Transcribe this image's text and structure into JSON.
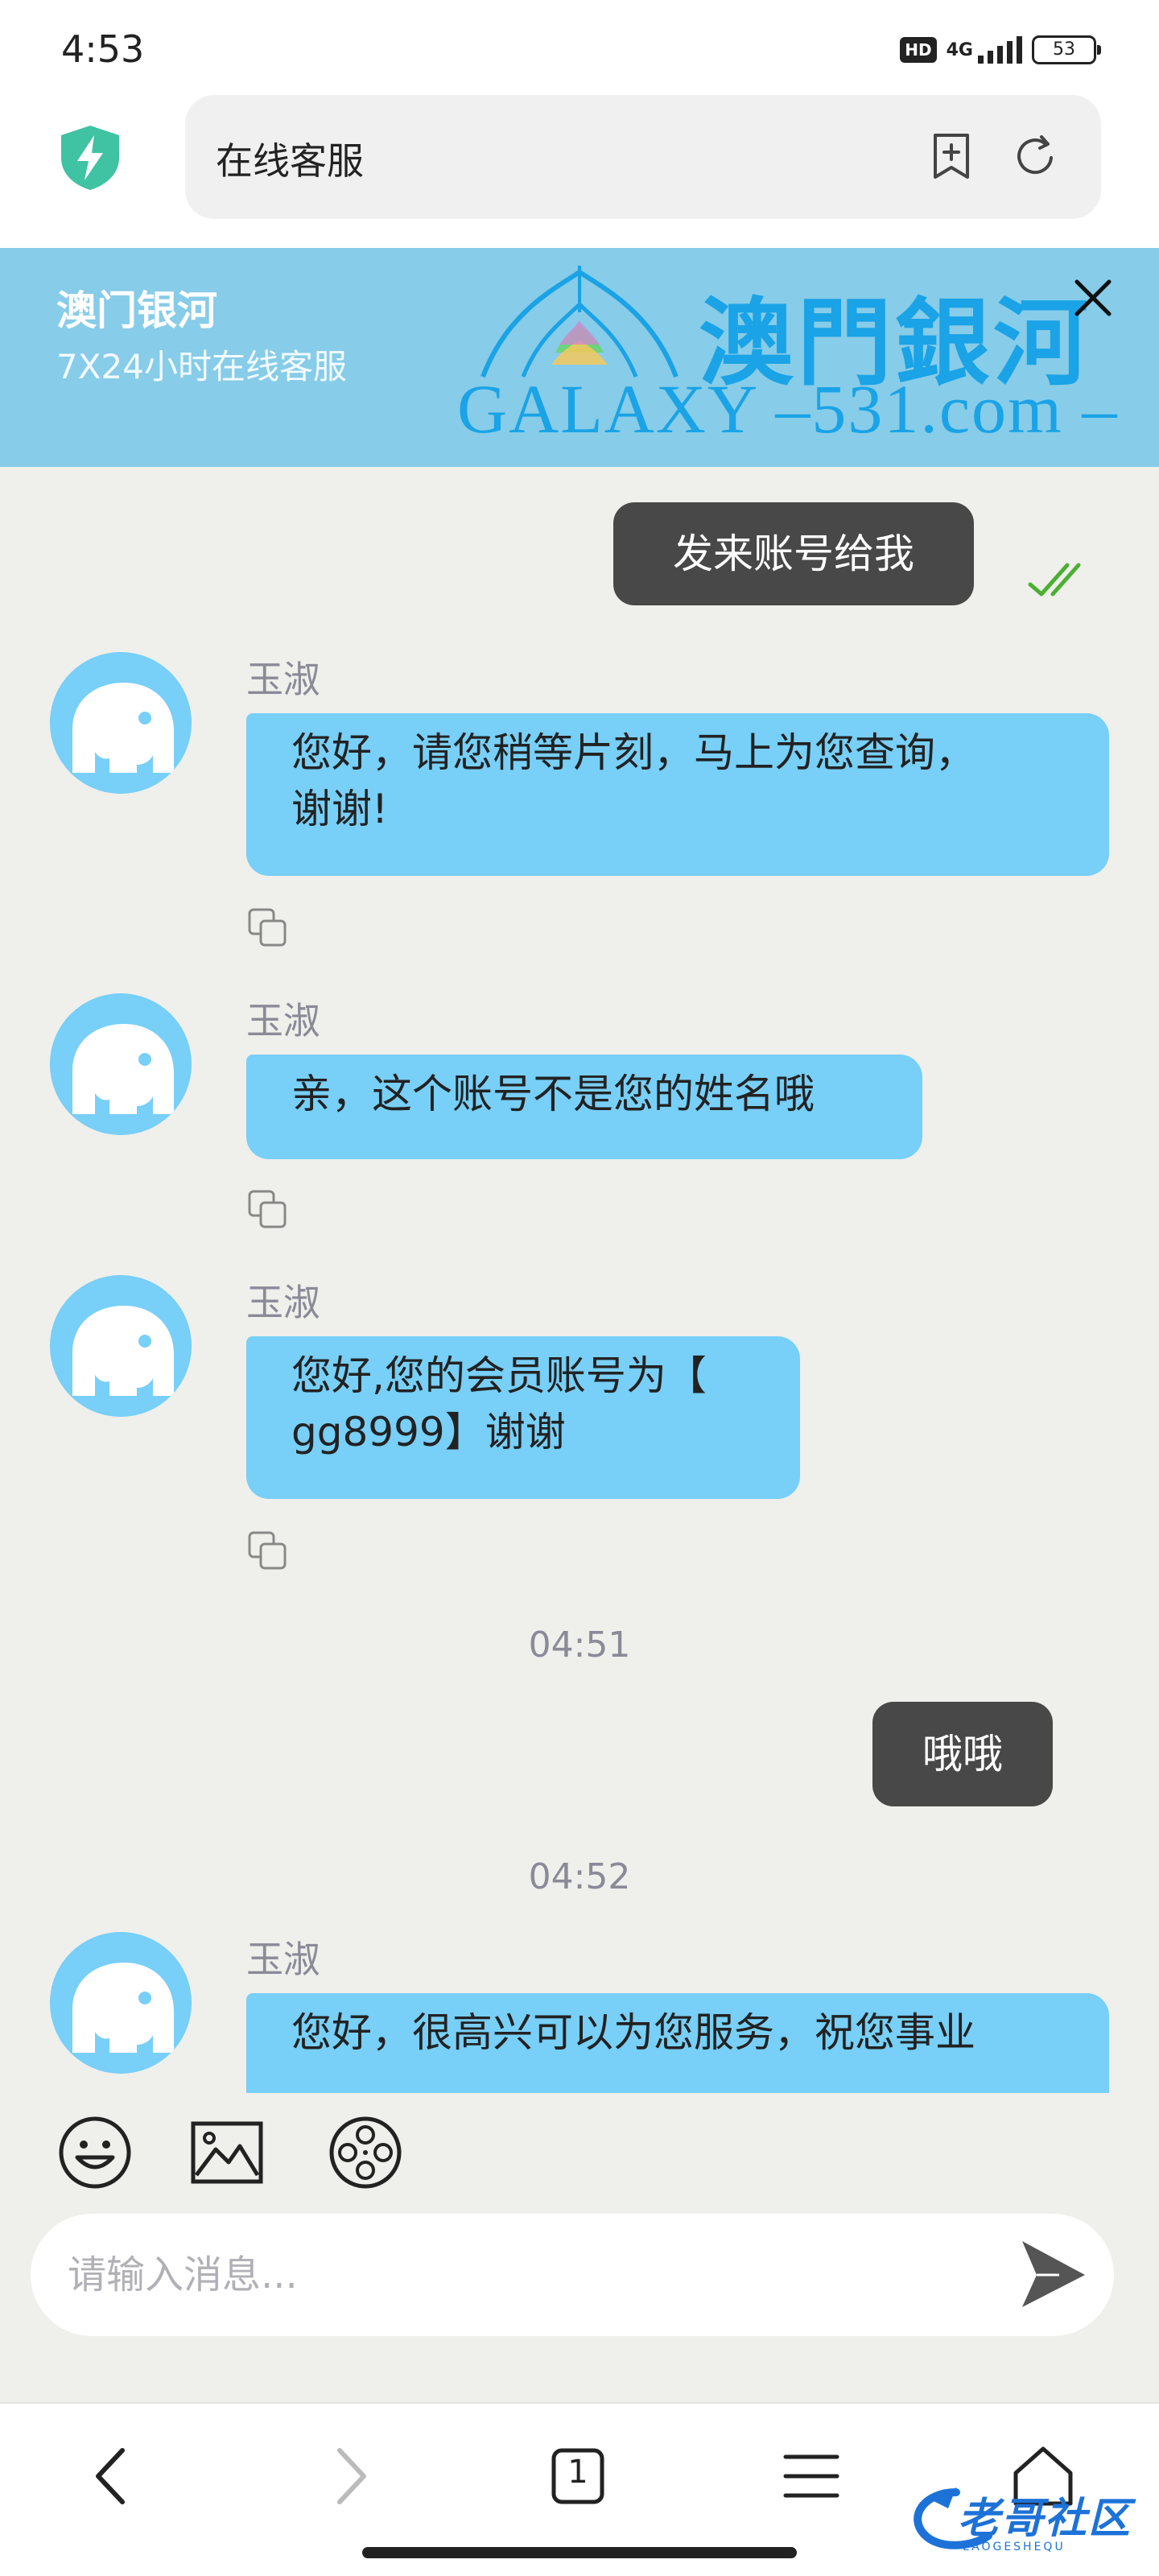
{
  "status_bar": {
    "time": "4:53",
    "hd_badge": "HD",
    "network": "4G",
    "battery": "53"
  },
  "browser": {
    "page_title": "在线客服",
    "security_icon": "shield-bolt-icon",
    "bookmark_icon": "add-bookmark-icon",
    "refresh_icon": "refresh-icon"
  },
  "chat_header": {
    "title": "澳门银河",
    "subtitle": "7X24小时在线客服",
    "logo_cn": "澳門銀河",
    "logo_en": "GALAXY –531.com –",
    "close_icon": "close-icon"
  },
  "messages": [
    {
      "side": "out",
      "text": "发来账号给我",
      "read": true
    },
    {
      "side": "in",
      "sender": "玉淑",
      "lines": [
        "您好，请您稍等片刻，马上为您查询，",
        "谢谢!"
      ]
    },
    {
      "side": "in",
      "sender": "玉淑",
      "lines": [
        "亲，这个账号不是您的姓名哦"
      ]
    },
    {
      "side": "in",
      "sender": "玉淑",
      "lines": [
        "您好,您的会员账号为【",
        "gg8999】谢谢"
      ]
    },
    {
      "type": "time",
      "text": "04:51"
    },
    {
      "side": "out",
      "text": "哦哦"
    },
    {
      "type": "time",
      "text": "04:52"
    },
    {
      "side": "in",
      "sender": "玉淑",
      "lines": [
        "您好，很高兴可以为您服务，祝您事业"
      ]
    }
  ],
  "composer": {
    "placeholder": "请输入消息...",
    "tools": [
      "emoji-icon",
      "image-icon",
      "video-reel-icon"
    ],
    "send_icon": "send-icon"
  },
  "bottom_nav": {
    "tab_count": "1",
    "items": [
      "back-icon",
      "forward-icon",
      "tabs-icon",
      "menu-icon",
      "home-icon"
    ]
  },
  "watermark": {
    "text": "老哥社区",
    "sub": "LAOGESHEQU"
  },
  "colors": {
    "header_bg": "#87cce8",
    "incoming_bubble": "#78cff7",
    "outgoing_bubble": "#484848",
    "read_check": "#4caf32",
    "background": "#efefeb"
  }
}
